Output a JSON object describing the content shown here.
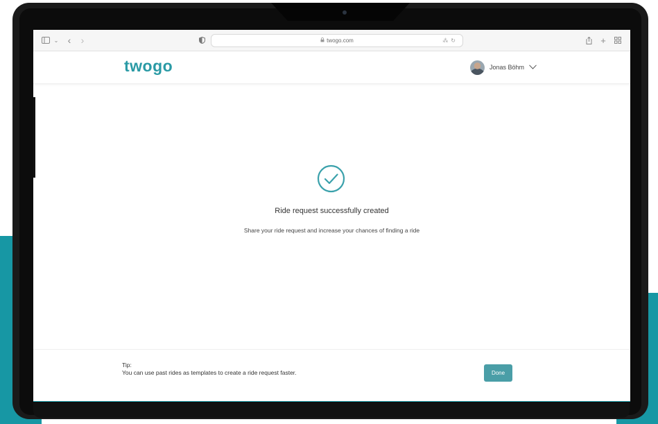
{
  "browser": {
    "url": "twogo.com",
    "icons": {
      "sidebar": "sidebar-icon",
      "back": "chevron-left-icon",
      "forward": "chevron-right-icon",
      "privacy": "shield-icon",
      "lock": "lock-icon",
      "translate": "translate-icon",
      "reload": "reload-icon",
      "share": "share-icon",
      "new_tab": "plus-icon",
      "tabs": "tab-grid-icon"
    }
  },
  "header": {
    "logo_text": "twogo",
    "user_name": "Jonas Böhm"
  },
  "main": {
    "title": "Ride request successfully created",
    "subtitle": "Share your ride request and increase your chances of finding a ride"
  },
  "footer": {
    "tip_label": "Tip:",
    "tip_text": "You can use past rides as templates to create a ride request faster.",
    "done_label": "Done"
  },
  "colors": {
    "teal": "#1797a4",
    "button": "#4a9ea7",
    "logo_teal": "#2a9aa5",
    "logo_green": "#8bbf3d"
  }
}
